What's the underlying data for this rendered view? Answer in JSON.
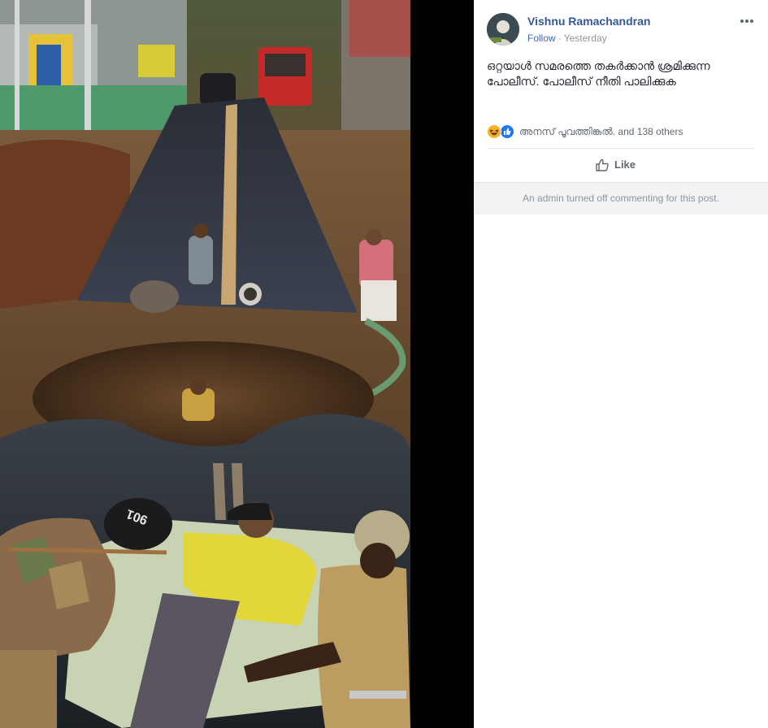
{
  "post": {
    "author": "Vishnu Ramachandran",
    "follow_label": "Follow",
    "separator": "·",
    "timestamp": "Yesterday",
    "text": "ഒറ്റയാൾ സമരത്തെ തകർക്കാൻ ശ്രമിക്കുന്ന പോലീസ്. പോലീസ് നീതി പാലിക്കുക",
    "more_icon": "more-horizontal-icon"
  },
  "reactions": {
    "icons": [
      "haha-icon",
      "like-icon"
    ],
    "summary": "അനസ് പൂവത്തിങ്കൽ. and 138 others"
  },
  "actions": {
    "like_label": "Like",
    "like_icon": "thumbs-up-icon"
  },
  "comments": {
    "notice": "An admin turned off commenting for this post."
  },
  "colors": {
    "link_blue": "#365899",
    "follow_blue": "#4267b2",
    "meta_gray": "#90949c",
    "text_dark": "#1d2129",
    "notice_bg": "#f2f3f5",
    "photo_backdrop": "#000000"
  },
  "photo": {
    "plate_text": "901"
  }
}
